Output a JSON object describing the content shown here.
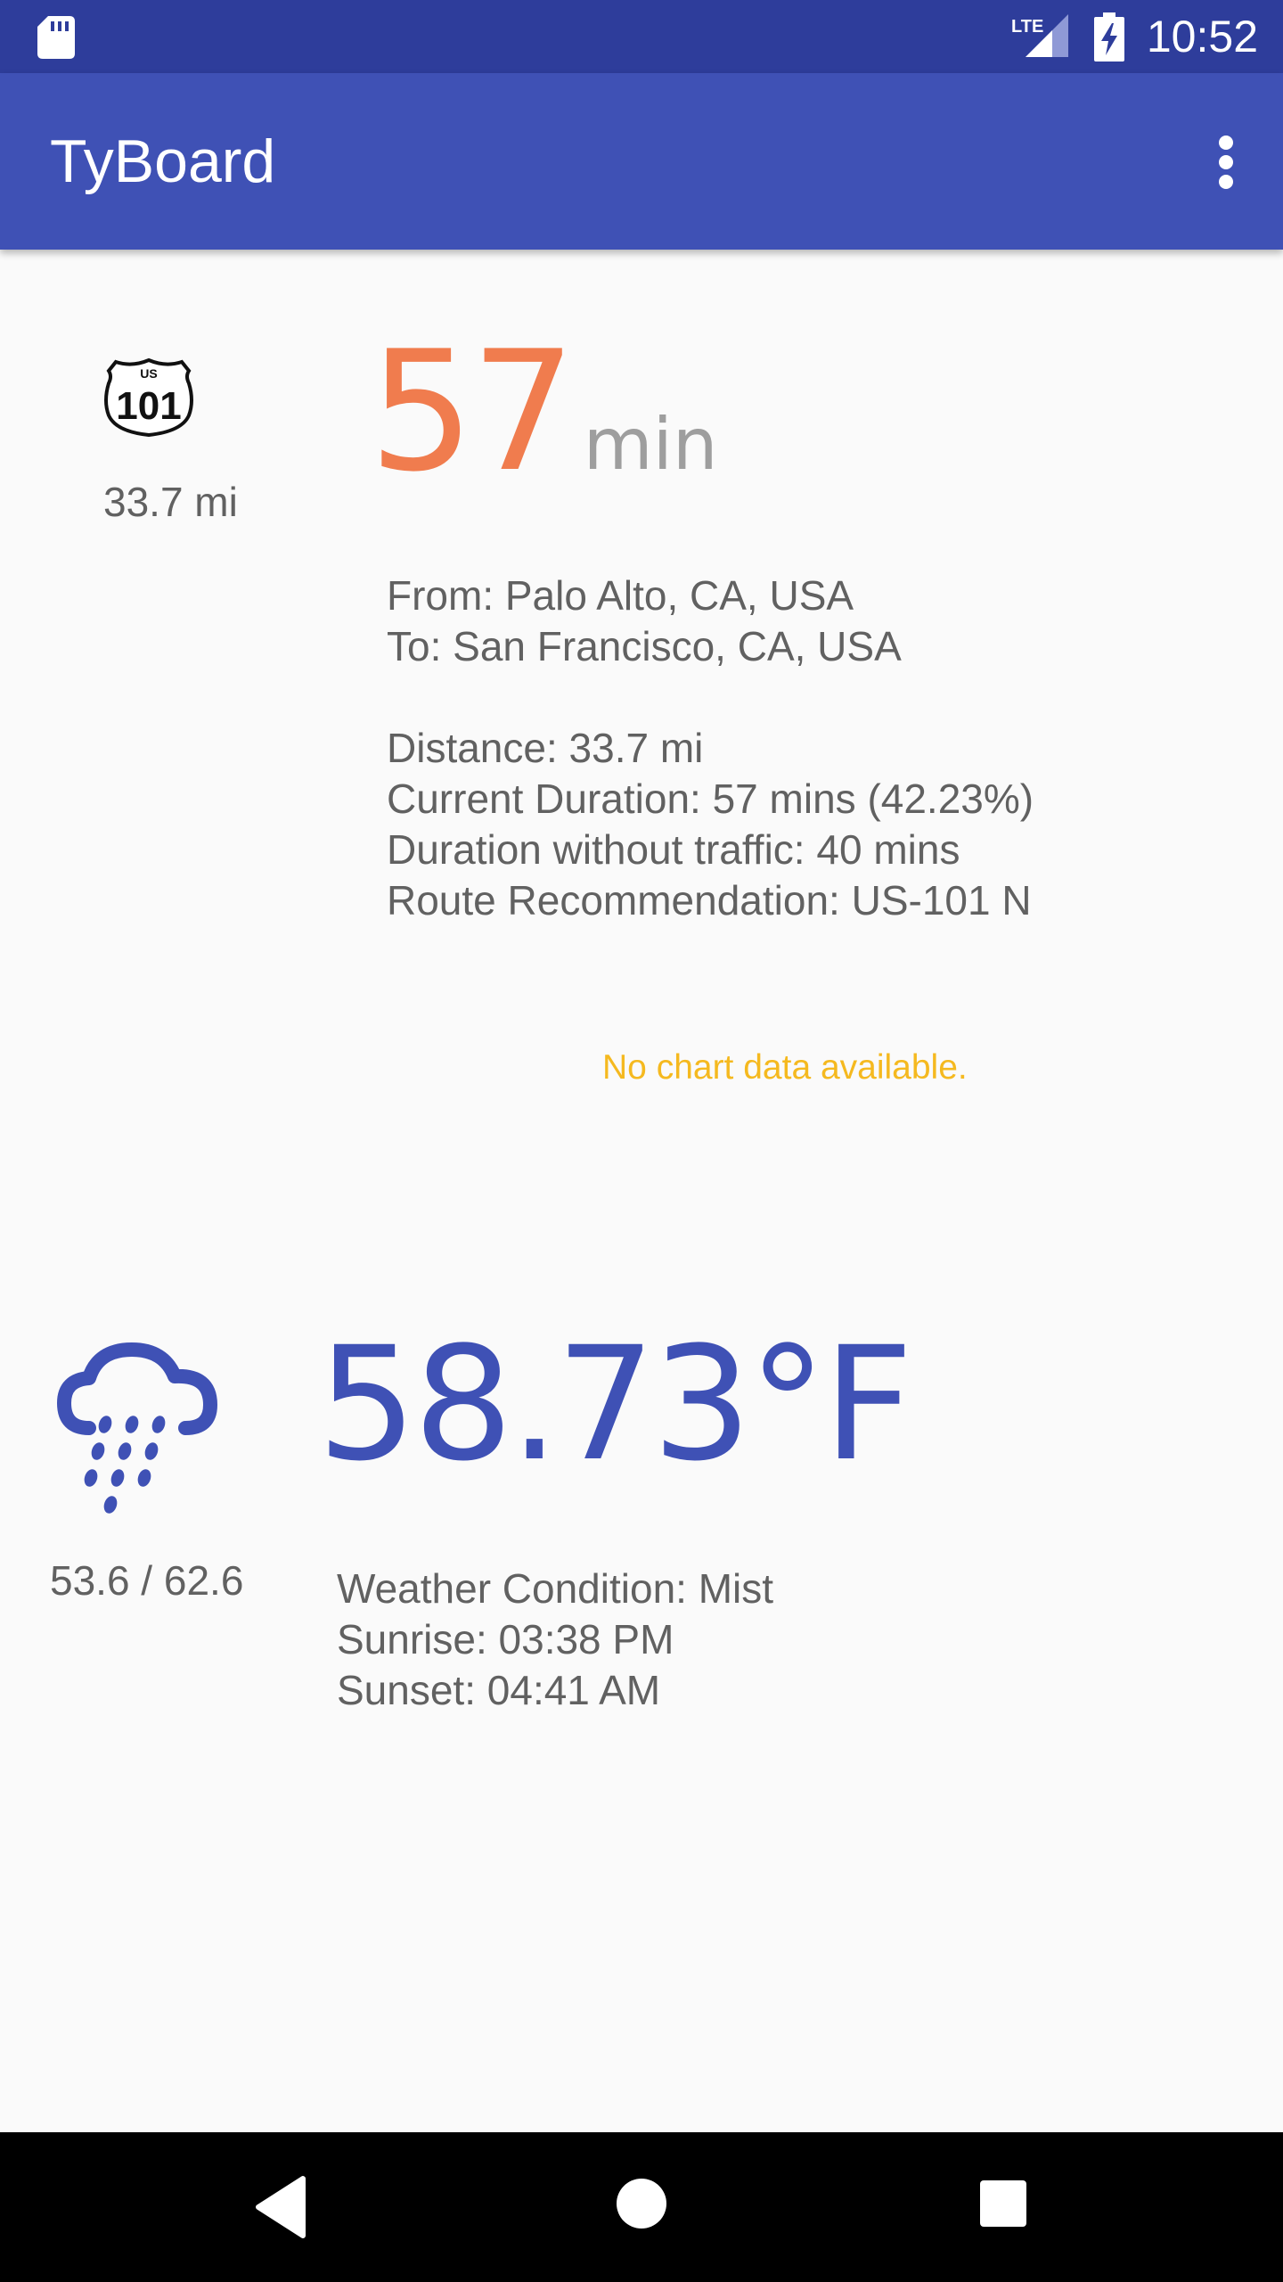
{
  "status_bar": {
    "time": "10:52",
    "network": "LTE",
    "icons": [
      "sd-card-icon",
      "signal-icon",
      "battery-charging-icon"
    ]
  },
  "app_bar": {
    "title": "TyBoard",
    "menu_icon": "more-vert-icon"
  },
  "traffic": {
    "route_shield": {
      "top_text": "US",
      "number": "101"
    },
    "distance": "33.7 mi",
    "duration_value": "57",
    "duration_unit": "min",
    "from": "From: Palo Alto, CA, USA",
    "to": "To: San Francisco, CA, USA",
    "distance_detail": "Distance: 33.7 mi",
    "current_duration": "Current Duration: 57 mins (42.23%)",
    "duration_without_traffic": "Duration without traffic: 40 mins",
    "route_recommendation": "Route Recommendation: US-101 N",
    "no_chart": "No chart data available.",
    "accent_color": "#f07c4e"
  },
  "weather": {
    "icon": "rain-cloud-icon",
    "temperature": "58.73°F",
    "range": "53.6 / 62.6",
    "condition": "Weather Condition: Mist",
    "sunrise": "Sunrise: 03:38 PM",
    "sunset": "Sunset: 04:41 AM",
    "accent_color": "#3f51b5"
  },
  "nav_bar": {
    "buttons": [
      "back-icon",
      "home-icon",
      "recents-icon"
    ]
  }
}
